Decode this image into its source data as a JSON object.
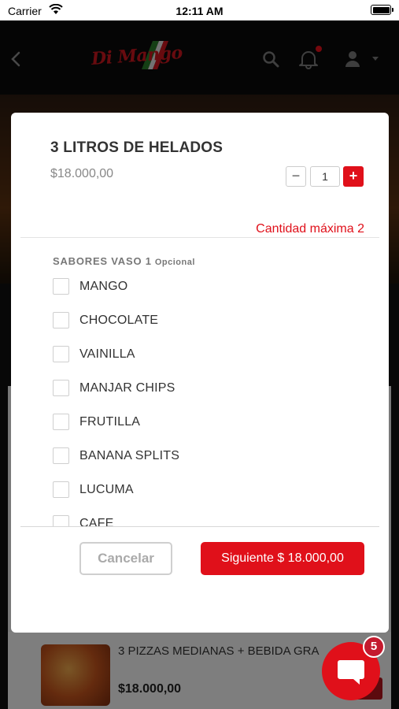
{
  "status_bar": {
    "carrier": "Carrier",
    "time": "12:11 AM"
  },
  "header": {
    "logo_text": "Di Mango",
    "icons": [
      "back-icon",
      "search-icon",
      "bell-icon",
      "user-icon"
    ]
  },
  "background": {
    "product_title": "3 PIZZAS MEDIANAS + BEBIDA GRA",
    "product_price": "$18.000,00"
  },
  "modal": {
    "title": "3 LITROS DE HELADOS",
    "price": "$18.000,00",
    "quantity": "1",
    "minus_label": "−",
    "plus_label": "+",
    "max_quantity_text": "Cantidad máxima 2",
    "group": {
      "title": "SABORES VASO 1",
      "optional_label": "Opcional",
      "options": [
        "MANGO",
        "CHOCOLATE",
        "VAINILLA",
        "MANJAR CHIPS",
        "FRUTILLA",
        "BANANA SPLITS",
        "LUCUMA",
        "CAFE"
      ]
    },
    "cancel_label": "Cancelar",
    "next_label": "Siguiente $ 18.000,00"
  },
  "chat": {
    "badge_count": "5"
  },
  "colors": {
    "accent": "#e0101a",
    "modal_bg": "#ffffff",
    "overlay": "rgba(0,0,0,0.48)"
  }
}
